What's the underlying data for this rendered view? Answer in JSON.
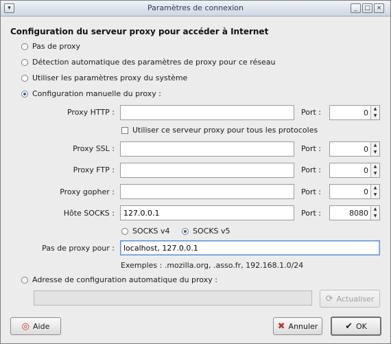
{
  "window": {
    "title": "Paramètres de connexion"
  },
  "heading": "Configuration du serveur proxy pour accéder à Internet",
  "options": {
    "no_proxy": "Pas de proxy",
    "auto_detect": "Détection automatique des paramètres de proxy pour ce réseau",
    "system": "Utiliser les paramètres proxy du système",
    "manual": "Configuration manuelle du proxy :",
    "auto_url": "Adresse de configuration automatique du proxy :"
  },
  "manual": {
    "http": {
      "label": "Proxy HTTP :",
      "value": "",
      "port_label": "Port :",
      "port": "0"
    },
    "same_for_all": "Utiliser ce serveur proxy pour tous les protocoles",
    "ssl": {
      "label": "Proxy SSL :",
      "value": "",
      "port_label": "Port :",
      "port": "0"
    },
    "ftp": {
      "label": "Proxy FTP :",
      "value": "",
      "port_label": "Port :",
      "port": "0"
    },
    "gopher": {
      "label": "Proxy gopher :",
      "value": "",
      "port_label": "Port :",
      "port": "0"
    },
    "socks": {
      "label": "Hôte SOCKS :",
      "value": "127.0.0.1",
      "port_label": "Port :",
      "port": "8080"
    },
    "socks_v4": "SOCKS v4",
    "socks_v5": "SOCKS v5",
    "no_proxy_for": {
      "label": "Pas de proxy pour :",
      "value": "localhost, 127.0.0.1"
    },
    "examples": "Exemples : .mozilla.org, .asso.fr, 192.168.1.0/24"
  },
  "auto_config": {
    "url": "",
    "reload_label": "Actualiser"
  },
  "buttons": {
    "help": "Aide",
    "cancel": "Annuler",
    "ok": "OK"
  },
  "selected": {
    "mode": "manual",
    "socks_version": "v5",
    "same_for_all": false
  }
}
